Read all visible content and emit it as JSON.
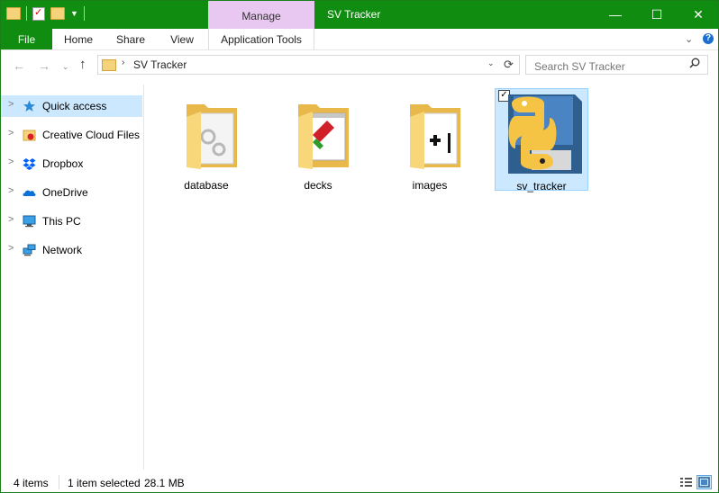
{
  "window": {
    "title": "SV Tracker",
    "context_tab": "Manage"
  },
  "window_controls": {
    "minimize": "—",
    "maximize": "☐",
    "close": "✕"
  },
  "ribbon": {
    "tabs": [
      "File",
      "Home",
      "Share",
      "View",
      "Application Tools"
    ],
    "expand_glyph": "⌄",
    "help_glyph": "?"
  },
  "navigation": {
    "back": "←",
    "forward": "→",
    "recent": "⌄",
    "up": "↑"
  },
  "address": {
    "path": "SV Tracker",
    "separator": "›",
    "dropdown": "⌄",
    "refresh": "⟳"
  },
  "search": {
    "placeholder": "Search SV Tracker"
  },
  "nav_pane": {
    "items": [
      {
        "label": "Quick access",
        "icon": "star-icon",
        "selected": true
      },
      {
        "label": "Creative Cloud Files",
        "icon": "creative-cloud-icon"
      },
      {
        "label": "Dropbox",
        "icon": "dropbox-icon"
      },
      {
        "label": "OneDrive",
        "icon": "onedrive-icon"
      },
      {
        "label": "This PC",
        "icon": "computer-icon"
      },
      {
        "label": "Network",
        "icon": "network-icon"
      }
    ]
  },
  "files": [
    {
      "name": "database",
      "icon": "folder-icon"
    },
    {
      "name": "decks",
      "icon": "folder-icon"
    },
    {
      "name": "images",
      "icon": "folder-icon"
    },
    {
      "name": "sv_tracker",
      "icon": "python-file-icon",
      "selected": true
    }
  ],
  "status": {
    "item_count": "4 items",
    "selection": "1 item selected",
    "size": "28.1 MB"
  },
  "colors": {
    "titlebar": "#108c10",
    "manage": "#e8c8f0",
    "selection": "#cce8ff",
    "accent": "#0078d7"
  }
}
